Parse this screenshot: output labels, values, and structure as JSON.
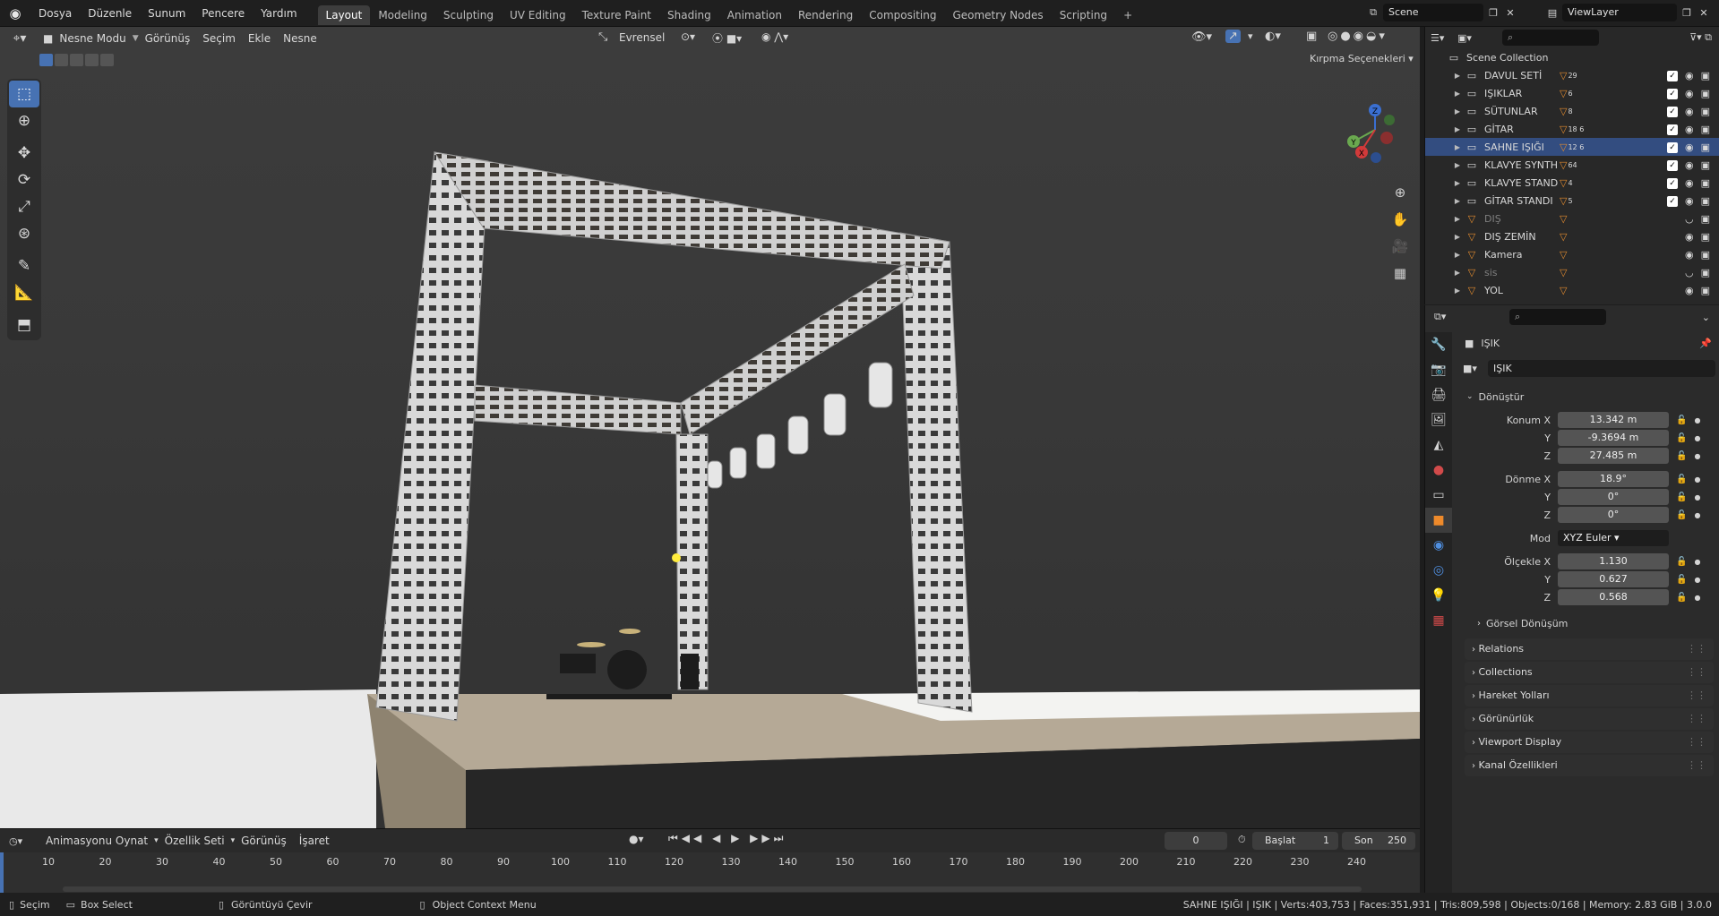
{
  "topbar": {
    "menus": [
      "Dosya",
      "Düzenle",
      "Sunum",
      "Pencere",
      "Yardım"
    ],
    "workspaces": [
      "Layout",
      "Modeling",
      "Sculpting",
      "UV Editing",
      "Texture Paint",
      "Shading",
      "Animation",
      "Rendering",
      "Compositing",
      "Geometry Nodes",
      "Scripting"
    ],
    "active_workspace": "Layout",
    "add_tab": "+",
    "scene_name": "Scene",
    "view_layer": "ViewLayer"
  },
  "viewport": {
    "mode": "Nesne Modu",
    "menus": [
      "Görünüş",
      "Seçim",
      "Ekle",
      "Nesne"
    ],
    "orientation": "Evrensel",
    "clip_options": "Kırpma Seçenekleri",
    "gizmo_axes": {
      "z": "Z",
      "y": "Y",
      "x": "X"
    },
    "accent": "#4772b3"
  },
  "outliner": {
    "root": "Scene Collection",
    "items": [
      {
        "label": "DAVUL SETİ",
        "badge": "29",
        "selected": false,
        "dim": false,
        "checkbox": true
      },
      {
        "label": "IŞIKLAR",
        "badge": "6",
        "selected": false,
        "dim": false,
        "checkbox": true
      },
      {
        "label": "SÜTUNLAR",
        "badge": "8",
        "selected": false,
        "dim": false,
        "checkbox": true
      },
      {
        "label": "GİTAR",
        "badge": "18 6",
        "selected": false,
        "dim": false,
        "checkbox": true
      },
      {
        "label": "SAHNE IŞIĞI",
        "badge": "12 6",
        "selected": true,
        "dim": false,
        "checkbox": true
      },
      {
        "label": "KLAVYE SYNTH",
        "badge": "64",
        "selected": false,
        "dim": false,
        "checkbox": true
      },
      {
        "label": "KLAVYE STAND",
        "badge": "4",
        "selected": false,
        "dim": false,
        "checkbox": true
      },
      {
        "label": "GİTAR STANDI",
        "badge": "5",
        "selected": false,
        "dim": false,
        "checkbox": true
      },
      {
        "label": "DIŞ",
        "badge": "",
        "selected": false,
        "dim": true,
        "checkbox": false
      },
      {
        "label": "DIŞ ZEMİN",
        "badge": "",
        "selected": false,
        "dim": false,
        "checkbox": false
      },
      {
        "label": "Kamera",
        "badge": "",
        "selected": false,
        "dim": false,
        "checkbox": false
      },
      {
        "label": "sis",
        "badge": "",
        "selected": false,
        "dim": true,
        "checkbox": false
      },
      {
        "label": "YOL",
        "badge": "",
        "selected": false,
        "dim": false,
        "checkbox": false
      }
    ]
  },
  "properties": {
    "object_name": "IŞIK",
    "object_field": "IŞIK",
    "transform_title": "Dönüştür",
    "location_label": "Konum X",
    "location": [
      "13.342 m",
      "-9.3694 m",
      "27.485 m"
    ],
    "rotation_label": "Dönme X",
    "rotation": [
      "18.9°",
      "0°",
      "0°"
    ],
    "mode_label": "Mod",
    "mode_value": "XYZ Euler",
    "scale_label": "Ölçekle X",
    "scale": [
      "1.130",
      "0.627",
      "0.568"
    ],
    "y_label": "Y",
    "z_label": "Z",
    "delta_transform": "Görsel Dönüşüm",
    "panels": [
      "Relations",
      "Collections",
      "Hareket Yolları",
      "Görünürlük",
      "Viewport Display",
      "Kanal Özellikleri"
    ]
  },
  "timeline": {
    "menus": [
      "Animasyonu Oynat",
      "Özellik Seti",
      "Görünüş",
      "İşaret"
    ],
    "current_frame": "0",
    "start_label": "Başlat",
    "start": "1",
    "end_label": "Son",
    "end": "250",
    "ticks": [
      "10",
      "20",
      "30",
      "40",
      "50",
      "60",
      "70",
      "80",
      "90",
      "100",
      "110",
      "120",
      "130",
      "140",
      "150",
      "160",
      "170",
      "180",
      "190",
      "200",
      "210",
      "220",
      "230",
      "240"
    ]
  },
  "status": {
    "select": "Seçim",
    "box_select": "Box Select",
    "rotate_view": "Görüntüyü Çevir",
    "context_menu": "Object Context Menu",
    "stats": "SAHNE IŞIĞI | IŞIK | Verts:403,753 | Faces:351,931 | Tris:809,598 | Objects:0/168 | Memory: 2.83 GiB | 3.0.0"
  }
}
